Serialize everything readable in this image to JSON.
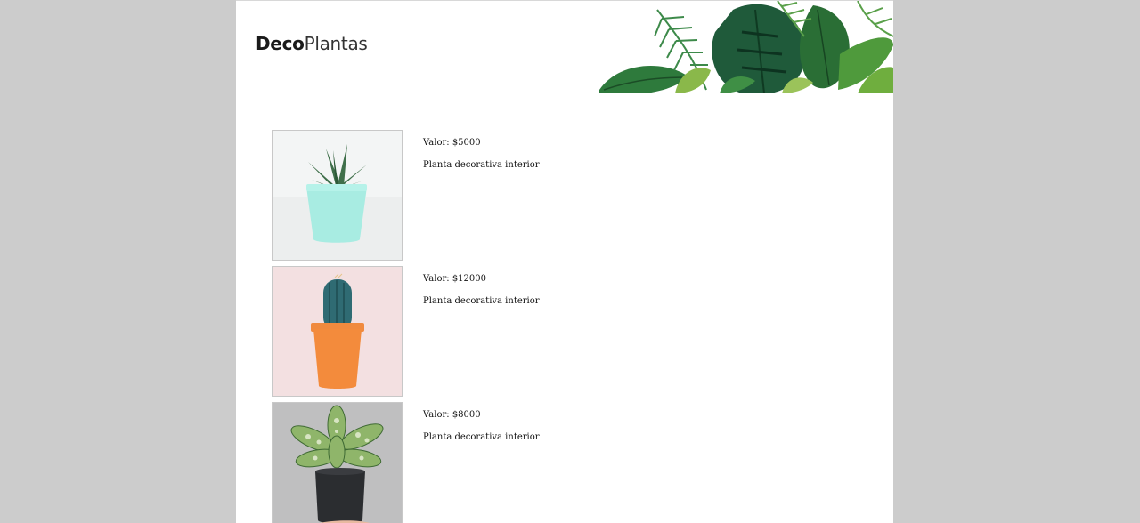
{
  "brand": {
    "bold": "Deco",
    "light": "Plantas"
  },
  "products": [
    {
      "price": "Valor: $5000",
      "description": "Planta decorativa interior",
      "image_icon": "succulent-in-mint-pot",
      "background": "#f1f3f3"
    },
    {
      "price": "Valor: $12000",
      "description": "Planta decorativa interior",
      "image_icon": "cactus-in-orange-pot",
      "background": "#f2dedf"
    },
    {
      "price": "Valor: $8000",
      "description": "Planta decorativa interior",
      "image_icon": "dieffenbachia-in-black-pot",
      "background": "#bdbdbd"
    }
  ]
}
